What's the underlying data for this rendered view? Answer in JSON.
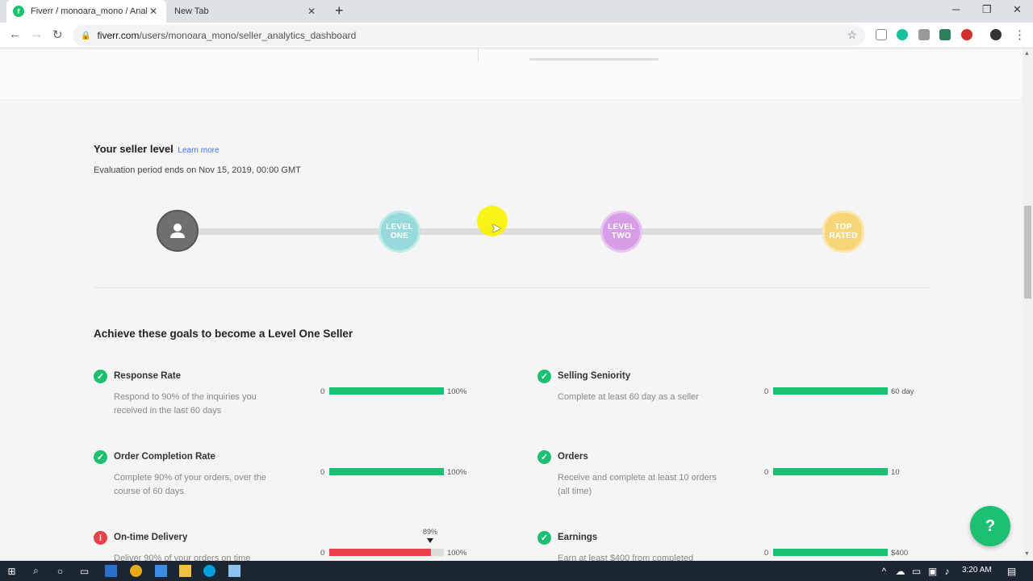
{
  "browser": {
    "active_tab_title": "Fiverr / monoara_mono / Analytic",
    "inactive_tab_title": "New Tab",
    "url_host": "fiverr.com",
    "url_path": "/users/monoara_mono/seller_analytics_dashboard"
  },
  "seller_level": {
    "title": "Your seller level",
    "learn_more": "Learn more",
    "evaluation": "Evaluation period ends on Nov 15, 2019, 00:00 GMT",
    "levels": [
      {
        "label": "LEVEL ONE",
        "color": "#96dada"
      },
      {
        "label": "LEVEL TWO",
        "color": "#d79de7"
      },
      {
        "label": "TOP RATED",
        "color": "#f7d679"
      }
    ]
  },
  "goals": {
    "title": "Achieve these goals to become a Level One Seller",
    "items": [
      {
        "name": "Response Rate",
        "desc": "Respond to 90% of the inquiries you received in the last 60 days",
        "min": "0",
        "target": "100%",
        "progress": 1.0,
        "status": "ok"
      },
      {
        "name": "Selling Seniority",
        "desc": "Complete at least 60 day as a seller",
        "min": "0",
        "target": "60 day",
        "progress": 1.0,
        "status": "ok"
      },
      {
        "name": "Order Completion Rate",
        "desc": "Complete 90% of your orders, over the course of 60 days",
        "min": "0",
        "target": "100%",
        "progress": 1.0,
        "status": "ok"
      },
      {
        "name": "Orders",
        "desc": "Receive and complete at least 10 orders (all time)",
        "min": "0",
        "target": "10",
        "progress": 1.0,
        "status": "ok"
      },
      {
        "name": "On-time Delivery",
        "desc": "Deliver 90% of your orders on time",
        "min": "0",
        "target": "100%",
        "progress": 0.89,
        "value_label": "89%",
        "status": "bad"
      },
      {
        "name": "Earnings",
        "desc": "Earn at least $400 from completed",
        "min": "0",
        "target": "$400",
        "progress": 1.0,
        "status": "ok"
      }
    ]
  },
  "help_label": "?",
  "taskbar": {
    "time": "3:20 AM"
  },
  "colors": {
    "brand": "#1dbf73",
    "danger": "#e9424b"
  }
}
